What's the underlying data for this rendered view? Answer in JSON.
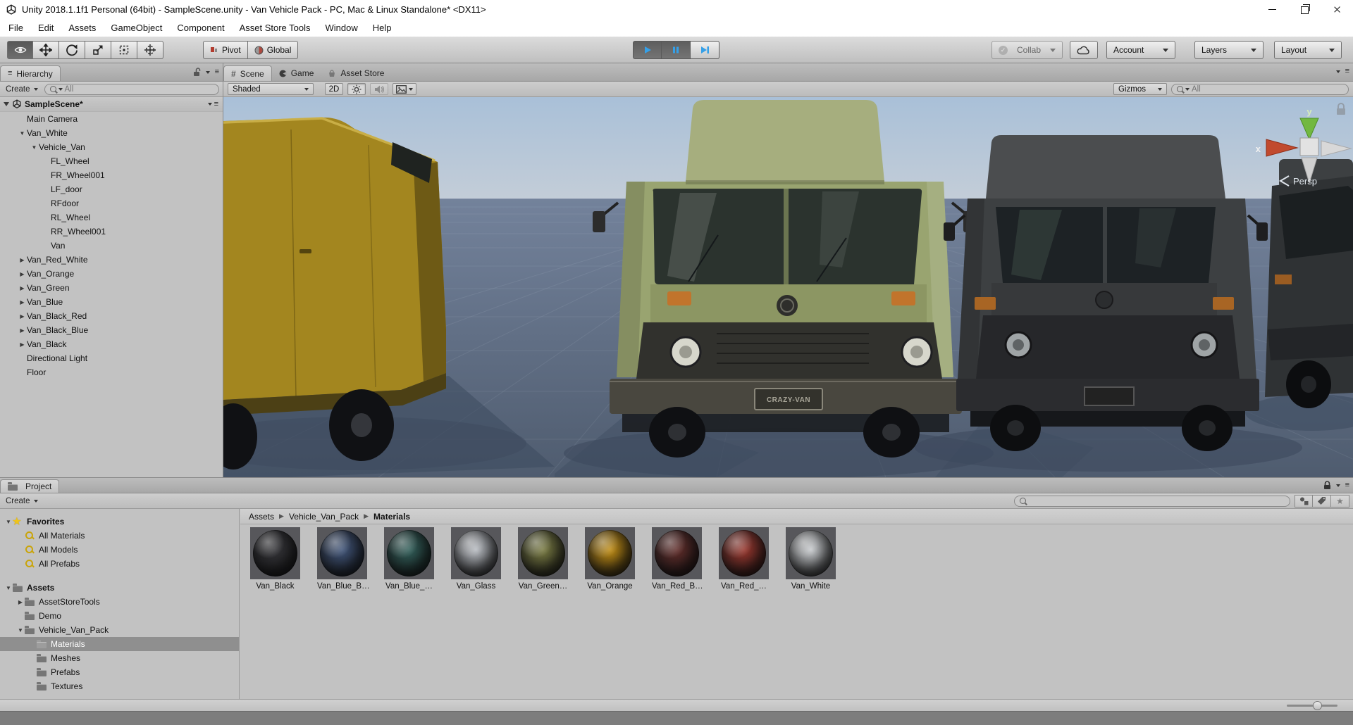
{
  "window": {
    "title": "Unity 2018.1.1f1 Personal (64bit) - SampleScene.unity - Van Vehicle Pack - PC, Mac & Linux Standalone* <DX11>"
  },
  "menu": {
    "items": [
      "File",
      "Edit",
      "Assets",
      "GameObject",
      "Component",
      "Asset Store Tools",
      "Window",
      "Help"
    ]
  },
  "toolbar": {
    "pivot": "Pivot",
    "global": "Global",
    "collab": "Collab",
    "account": "Account",
    "layers": "Layers",
    "layout": "Layout"
  },
  "hierarchy": {
    "tab": "Hierarchy",
    "create": "Create",
    "search_placeholder": "All",
    "scene_root": "SampleScene*",
    "items": [
      {
        "label": "Main Camera",
        "depth": 1,
        "arrow": ""
      },
      {
        "label": "Van_White",
        "depth": 1,
        "arrow": "▼"
      },
      {
        "label": "Vehicle_Van",
        "depth": 2,
        "arrow": "▼"
      },
      {
        "label": "FL_Wheel",
        "depth": 3,
        "arrow": ""
      },
      {
        "label": "FR_Wheel001",
        "depth": 3,
        "arrow": ""
      },
      {
        "label": "LF_door",
        "depth": 3,
        "arrow": ""
      },
      {
        "label": "RFdoor",
        "depth": 3,
        "arrow": ""
      },
      {
        "label": "RL_Wheel",
        "depth": 3,
        "arrow": ""
      },
      {
        "label": "RR_Wheel001",
        "depth": 3,
        "arrow": ""
      },
      {
        "label": "Van",
        "depth": 3,
        "arrow": ""
      },
      {
        "label": "Van_Red_White",
        "depth": 1,
        "arrow": "▶"
      },
      {
        "label": "Van_Orange",
        "depth": 1,
        "arrow": "▶"
      },
      {
        "label": "Van_Green",
        "depth": 1,
        "arrow": "▶"
      },
      {
        "label": "Van_Blue",
        "depth": 1,
        "arrow": "▶"
      },
      {
        "label": "Van_Black_Red",
        "depth": 1,
        "arrow": "▶"
      },
      {
        "label": "Van_Black_Blue",
        "depth": 1,
        "arrow": "▶"
      },
      {
        "label": "Van_Black",
        "depth": 1,
        "arrow": "▶"
      },
      {
        "label": "Directional Light",
        "depth": 1,
        "arrow": ""
      },
      {
        "label": "Floor",
        "depth": 1,
        "arrow": ""
      }
    ]
  },
  "scene": {
    "tabs": [
      "Scene",
      "Game",
      "Asset Store"
    ],
    "shading": "Shaded",
    "btn_2d": "2D",
    "gizmos": "Gizmos",
    "search_placeholder": "All",
    "persp": "Persp",
    "axis_x": "x",
    "axis_y": "y",
    "plate": "CRAZY-VAN"
  },
  "project": {
    "tab": "Project",
    "create": "Create",
    "breadcrumb": [
      "Assets",
      "Vehicle_Van_Pack",
      "Materials"
    ],
    "crumb_sep": "▶",
    "tree": [
      {
        "label": "Favorites",
        "depth": 0,
        "arrow": "▼",
        "icon": "star",
        "bold": true
      },
      {
        "label": "All Materials",
        "depth": 1,
        "arrow": "",
        "icon": "search"
      },
      {
        "label": "All Models",
        "depth": 1,
        "arrow": "",
        "icon": "search"
      },
      {
        "label": "All Prefabs",
        "depth": 1,
        "arrow": "",
        "icon": "search"
      },
      {
        "label": "",
        "spacer": true
      },
      {
        "label": "Assets",
        "depth": 0,
        "arrow": "▼",
        "icon": "folder",
        "bold": true
      },
      {
        "label": "AssetStoreTools",
        "depth": 1,
        "arrow": "▶",
        "icon": "folder"
      },
      {
        "label": "Demo",
        "depth": 1,
        "arrow": "",
        "icon": "folder"
      },
      {
        "label": "Vehicle_Van_Pack",
        "depth": 1,
        "arrow": "▼",
        "icon": "folder"
      },
      {
        "label": "Materials",
        "depth": 2,
        "arrow": "",
        "icon": "folder",
        "selected": true
      },
      {
        "label": "Meshes",
        "depth": 2,
        "arrow": "",
        "icon": "folder"
      },
      {
        "label": "Prefabs",
        "depth": 2,
        "arrow": "",
        "icon": "folder"
      },
      {
        "label": "Textures",
        "depth": 2,
        "arrow": "",
        "icon": "folder"
      }
    ],
    "materials": [
      {
        "label": "Van_Black",
        "color": "#323236"
      },
      {
        "label": "Van_Blue_B…",
        "color": "#3e5276"
      },
      {
        "label": "Van_Blue_…",
        "color": "#2f5c57"
      },
      {
        "label": "Van_Glass",
        "color": "#b6bac0"
      },
      {
        "label": "Van_Green…",
        "color": "#767840"
      },
      {
        "label": "Van_Orange",
        "color": "#bd8a12"
      },
      {
        "label": "Van_Red_B…",
        "color": "#5e2b28"
      },
      {
        "label": "Van_Red_…",
        "color": "#96352c"
      },
      {
        "label": "Van_White",
        "color": "#c6c9cc"
      }
    ]
  },
  "colors": {
    "accent_blue": "#35a0e8",
    "selection_gray": "#8f8f8f",
    "sky_top": "#a9c0d8",
    "sky_bottom": "#c3cdd8",
    "ground_top": "#73829b",
    "ground_bottom": "#4f5c6f",
    "scene_shadow": "#3d4a5e",
    "grid_line": "#dfe6f0",
    "van_yellow": "#a3861f",
    "van_green": "#99a470",
    "van_green_roof": "#a6ae7e",
    "van_dark": "#3d4042",
    "indicator_orange": "#c1742c",
    "star_yellow": "#f0c419"
  }
}
